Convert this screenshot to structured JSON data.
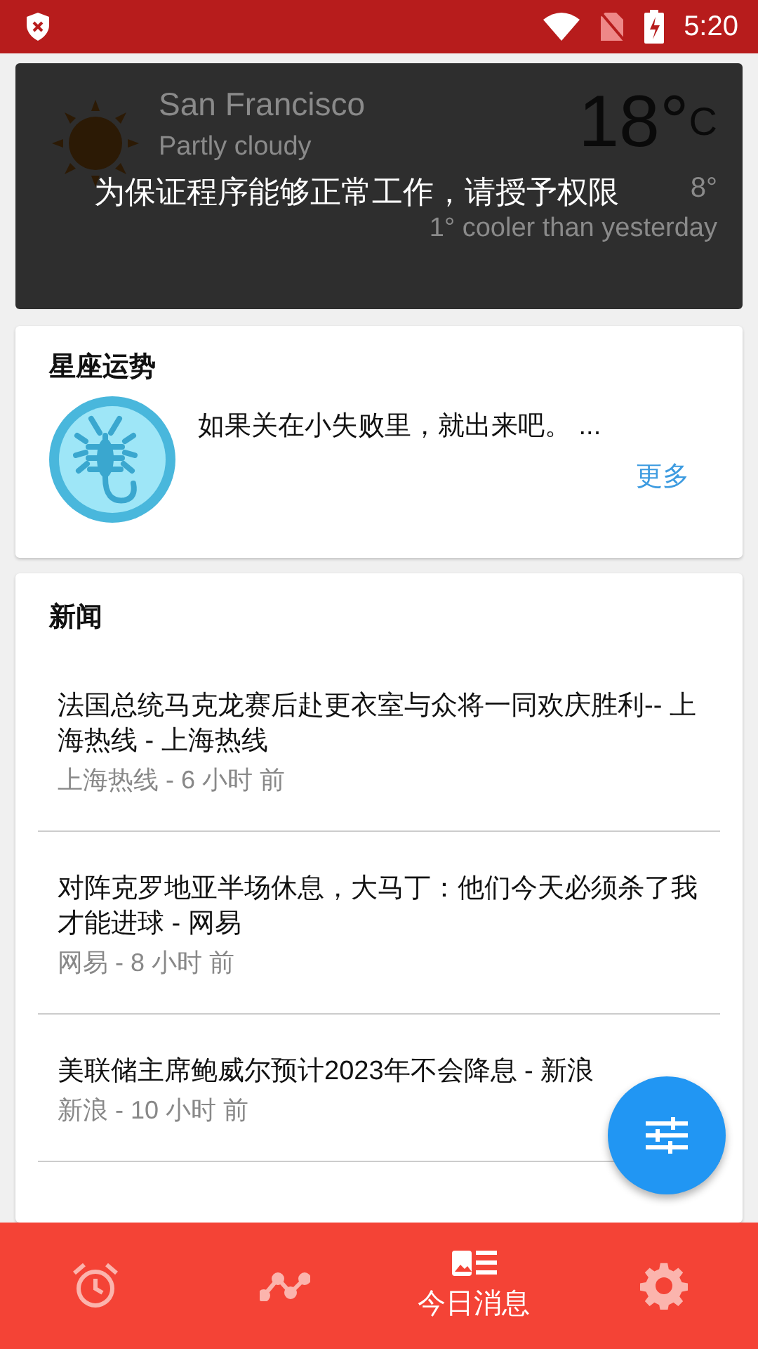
{
  "status_bar": {
    "time": "5:20"
  },
  "weather": {
    "city": "San Francisco",
    "condition": "Partly cloudy",
    "temperature": "18°",
    "unit": "C",
    "low": "8°",
    "comparison": "1° cooler than yesterday",
    "overlay_message": "为保证程序能够正常工作，请授予权限"
  },
  "horoscope": {
    "title": "星座运势",
    "text": "如果关在小失败里，就出来吧。 ...",
    "more": "更多"
  },
  "news": {
    "title": "新闻",
    "items": [
      {
        "headline": "法国总统马克龙赛后赴更衣室与众将一同欢庆胜利-- 上海热线 - 上海热线",
        "meta": "上海热线 - 6 小时 前"
      },
      {
        "headline": "对阵克罗地亚半场休息，大马丁：他们今天必须杀了我才能进球 - 网易",
        "meta": "网易 - 8 小时 前"
      },
      {
        "headline": "美联储主席鲍威尔预计2023年不会降息 - 新浪",
        "meta": "新浪 - 10 小时 前"
      }
    ]
  },
  "bottom_nav": [
    {
      "kind": "alarm",
      "selected": false
    },
    {
      "kind": "trend",
      "selected": false
    },
    {
      "kind": "news",
      "label": "今日消息",
      "selected": true
    },
    {
      "kind": "settings",
      "selected": false
    }
  ]
}
